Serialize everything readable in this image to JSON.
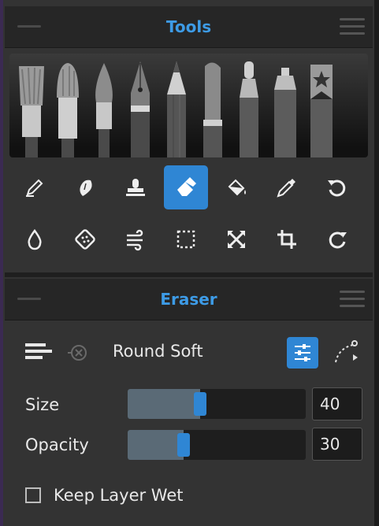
{
  "tools_panel": {
    "title": "Tools"
  },
  "brushes": [
    {
      "icon": "wide-brush-icon"
    },
    {
      "icon": "round-brush-icon"
    },
    {
      "icon": "pointed-brush-icon"
    },
    {
      "icon": "fountain-pen-icon"
    },
    {
      "icon": "pencil-icon"
    },
    {
      "icon": "marker-icon"
    },
    {
      "icon": "felt-pen-icon"
    },
    {
      "icon": "spray-can-icon"
    },
    {
      "icon": "bookmark-star-icon"
    }
  ],
  "tools": [
    {
      "icon": "ink-pen-icon",
      "active": false
    },
    {
      "icon": "smudge-icon",
      "active": false
    },
    {
      "icon": "stamp-icon",
      "active": false
    },
    {
      "icon": "eraser-icon",
      "active": true
    },
    {
      "icon": "fill-bucket-icon",
      "active": false
    },
    {
      "icon": "eyedropper-icon",
      "active": false
    },
    {
      "icon": "undo-icon",
      "active": false
    },
    {
      "icon": "water-drop-icon",
      "active": false
    },
    {
      "icon": "texture-sponge-icon",
      "active": false
    },
    {
      "icon": "wind-icon",
      "active": false
    },
    {
      "icon": "selection-icon",
      "active": false
    },
    {
      "icon": "transform-icon",
      "active": false
    },
    {
      "icon": "crop-icon",
      "active": false
    },
    {
      "icon": "redo-icon",
      "active": false
    }
  ],
  "eraser_panel": {
    "title": "Eraser",
    "preset_name": "Round Soft",
    "size_label": "Size",
    "size_value": "40",
    "size_fraction": 0.4,
    "opacity_label": "Opacity",
    "opacity_value": "30",
    "opacity_fraction": 0.3,
    "keep_wet_label": "Keep Layer Wet",
    "keep_wet_checked": false
  },
  "colors": {
    "accent": "#2f86d4",
    "title_blue": "#3d9be6"
  }
}
